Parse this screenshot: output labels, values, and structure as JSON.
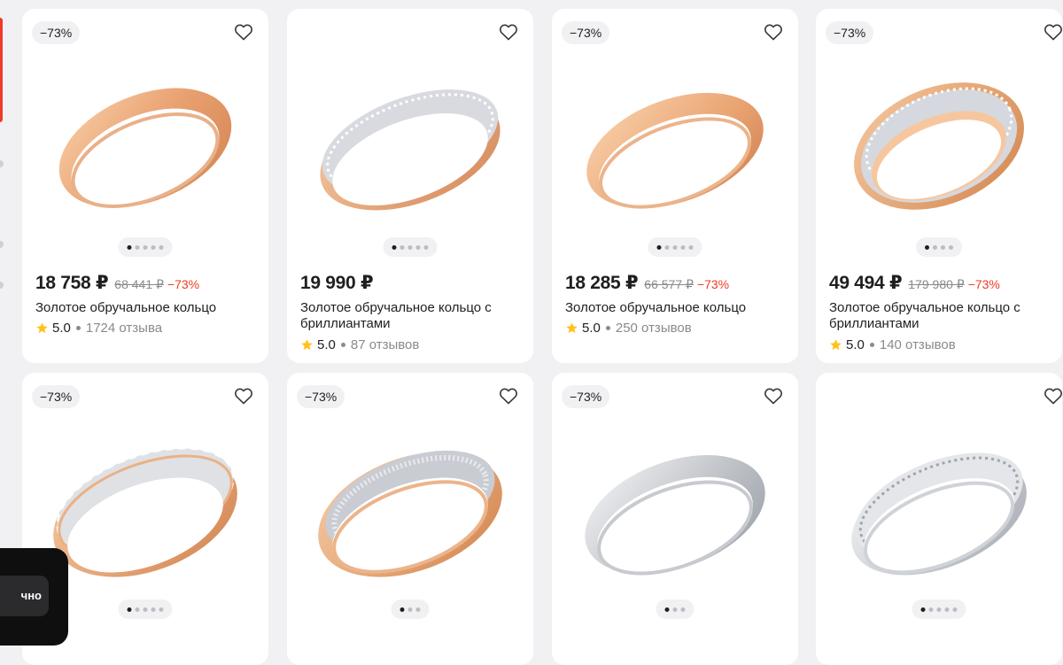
{
  "products": [
    {
      "discount_badge": "−73%",
      "price": "18 758 ₽",
      "old_price": "68 441 ₽",
      "discount": "−73%",
      "title": "Золотое обручальное кольцо",
      "rating": "5.0",
      "reviews": "1724 отзыва",
      "image_dots_total": 5,
      "image_dot_active": 1
    },
    {
      "discount_badge": "",
      "price": "19 990 ₽",
      "old_price": "",
      "discount": "",
      "title": "Золотое обручальное кольцо с бриллиантами",
      "rating": "5.0",
      "reviews": "87 отзывов",
      "image_dots_total": 5,
      "image_dot_active": 1
    },
    {
      "discount_badge": "−73%",
      "price": "18 285 ₽",
      "old_price": "66 577 ₽",
      "discount": "−73%",
      "title": "Золотое обручальное кольцо",
      "rating": "5.0",
      "reviews": "250 отзывов",
      "image_dots_total": 5,
      "image_dot_active": 1
    },
    {
      "discount_badge": "−73%",
      "price": "49 494 ₽",
      "old_price": "179 980 ₽",
      "discount": "−73%",
      "title": "Золотое обручальное кольцо с бриллиантами",
      "rating": "5.0",
      "reviews": "140 отзывов",
      "image_dots_total": 4,
      "image_dot_active": 1
    },
    {
      "discount_badge": "−73%",
      "price": "",
      "old_price": "",
      "discount": "",
      "title": "",
      "rating": "",
      "reviews": "",
      "image_dots_total": 5,
      "image_dot_active": 1
    },
    {
      "discount_badge": "−73%",
      "price": "",
      "old_price": "",
      "discount": "",
      "title": "",
      "rating": "",
      "reviews": "",
      "image_dots_total": 3,
      "image_dot_active": 1
    },
    {
      "discount_badge": "−73%",
      "price": "",
      "old_price": "",
      "discount": "",
      "title": "",
      "rating": "",
      "reviews": "",
      "image_dots_total": 3,
      "image_dot_active": 1
    },
    {
      "discount_badge": "",
      "price": "",
      "old_price": "",
      "discount": "",
      "title": "",
      "rating": "",
      "reviews": "",
      "image_dots_total": 5,
      "image_dot_active": 1
    }
  ],
  "cookie_toast": {
    "button_label": "чно"
  },
  "icons": {
    "favorite": "heart-icon",
    "rating": "star-icon"
  },
  "colors": {
    "accent": "#ef3b24",
    "star": "#ffc21a",
    "background": "#f1f1f4",
    "card": "#ffffff"
  }
}
